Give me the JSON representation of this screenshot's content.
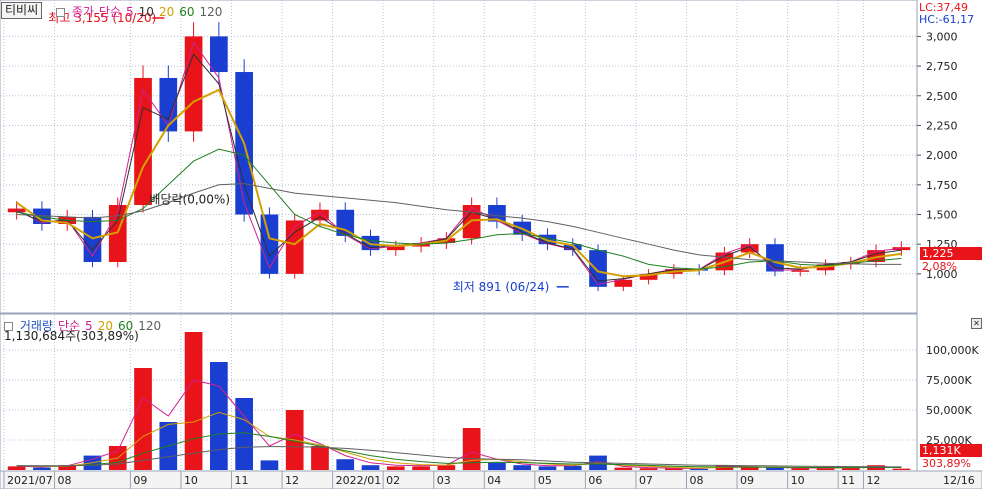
{
  "window": {
    "ticker": "티비씨"
  },
  "price_legend": {
    "items": [
      {
        "text": "종가",
        "color": "#d02090"
      },
      {
        "text": "단순",
        "color": "#d02090"
      },
      {
        "text": "5",
        "color": "#d02090"
      },
      {
        "text": "10",
        "color": "#303030"
      },
      {
        "text": "20",
        "color": "#d4a000"
      },
      {
        "text": "60",
        "color": "#208020"
      },
      {
        "text": "120",
        "color": "#606060"
      }
    ]
  },
  "volume_legend": {
    "items": [
      {
        "text": "거래량",
        "color": "#2050c0"
      },
      {
        "text": "단순",
        "color": "#d02090"
      },
      {
        "text": "5",
        "color": "#d02090"
      },
      {
        "text": "20",
        "color": "#d4a000"
      },
      {
        "text": "60",
        "color": "#208020"
      },
      {
        "text": "120",
        "color": "#606060"
      }
    ],
    "info": "1,130,684주(303,89%)"
  },
  "indicators": {
    "lc": "LC:37,49",
    "hc": "HC:-61,17"
  },
  "current": {
    "price_tag": "1,225",
    "change_tag": "2,08%",
    "vol_tag": "1,131K",
    "vol_pct_tag": "303,89%"
  },
  "colors": {
    "up": "#e8141a",
    "down": "#1a3fd0",
    "ma5": "#d02090",
    "ma10": "#303030",
    "ma20": "#d4a000",
    "ma60": "#208020",
    "ma120": "#606060",
    "grid": "#b8c4d8"
  },
  "chart_data": [
    {
      "type": "line",
      "title": "",
      "chart_kind": "candlestick with moving averages",
      "ylim": [
        780,
        3155
      ],
      "yticks": [
        "1,000",
        "1,250",
        "1,500",
        "1,750",
        "2,000",
        "2,250",
        "2,500",
        "2,750",
        "3,000"
      ],
      "yticks_values": [
        1000,
        1250,
        1500,
        1750,
        2000,
        2250,
        2500,
        2750,
        3000
      ],
      "x_ticks": [
        "2021/07",
        "08",
        "09",
        "10",
        "11",
        "12",
        "2022/01",
        "02",
        "03",
        "04",
        "05",
        "06",
        "07",
        "08",
        "09",
        "10",
        "11",
        "12",
        "12/16"
      ],
      "x": [
        "2021/07",
        "07",
        "08",
        "08",
        "09",
        "09",
        "10",
        "10",
        "11",
        "11",
        "12",
        "12",
        "2022/01",
        "01",
        "02",
        "02",
        "03",
        "03",
        "04",
        "04",
        "05",
        "05",
        "06",
        "06",
        "07",
        "07",
        "08",
        "08",
        "09",
        "09",
        "10",
        "10",
        "11",
        "11",
        "12",
        "12/16"
      ],
      "series": [
        {
          "name": "종가",
          "values": [
            1550,
            1420,
            1480,
            1100,
            1580,
            2650,
            2200,
            3000,
            2700,
            1500,
            1000,
            1450,
            1540,
            1320,
            1200,
            1230,
            1260,
            1300,
            1580,
            1440,
            1330,
            1250,
            1200,
            891,
            950,
            1000,
            1040,
            1030,
            1180,
            1250,
            1020,
            1030,
            1080,
            1100,
            1200,
            1225
          ]
        },
        {
          "name": "5",
          "values": [
            1540,
            1430,
            1460,
            1150,
            1520,
            2550,
            2250,
            2950,
            2650,
            1600,
            1050,
            1400,
            1520,
            1330,
            1210,
            1235,
            1260,
            1300,
            1560,
            1450,
            1340,
            1255,
            1205,
            910,
            955,
            1000,
            1040,
            1035,
            1170,
            1245,
            1030,
            1035,
            1080,
            1100,
            1190,
            1215
          ]
        },
        {
          "name": "10",
          "values": [
            1530,
            1440,
            1450,
            1200,
            1450,
            2400,
            2300,
            2850,
            2600,
            1750,
            1150,
            1350,
            1480,
            1340,
            1220,
            1240,
            1255,
            1295,
            1520,
            1460,
            1350,
            1260,
            1210,
            940,
            960,
            1000,
            1035,
            1035,
            1150,
            1230,
            1050,
            1040,
            1075,
            1100,
            1170,
            1200
          ]
        },
        {
          "name": "20",
          "values": [
            1600,
            1450,
            1430,
            1300,
            1350,
            1900,
            2250,
            2450,
            2550,
            2100,
            1300,
            1250,
            1420,
            1370,
            1250,
            1235,
            1250,
            1280,
            1450,
            1460,
            1380,
            1280,
            1240,
            1020,
            980,
            990,
            1020,
            1030,
            1100,
            1180,
            1100,
            1050,
            1060,
            1090,
            1140,
            1170
          ]
        },
        {
          "name": "60",
          "values": [
            1520,
            1480,
            1450,
            1440,
            1450,
            1550,
            1750,
            1950,
            2050,
            2000,
            1750,
            1500,
            1400,
            1330,
            1280,
            1260,
            1250,
            1260,
            1290,
            1330,
            1340,
            1300,
            1260,
            1200,
            1150,
            1080,
            1050,
            1040,
            1060,
            1100,
            1110,
            1080,
            1070,
            1090,
            1110,
            1130
          ]
        },
        {
          "name": "120",
          "values": [
            1500,
            1490,
            1480,
            1470,
            1490,
            1530,
            1600,
            1680,
            1750,
            1760,
            1720,
            1680,
            1660,
            1640,
            1620,
            1600,
            1570,
            1540,
            1520,
            1490,
            1470,
            1440,
            1400,
            1350,
            1300,
            1250,
            1200,
            1160,
            1140,
            1120,
            1110,
            1100,
            1090,
            1085,
            1080,
            1080
          ]
        }
      ],
      "annotations": [
        {
          "text": "최고 3,155 (10/20)",
          "x": "10",
          "y": 3155,
          "color": "#e8141a"
        },
        {
          "text": "배당락(0,00%)",
          "x": "12",
          "y": 1560,
          "color": "#222222"
        },
        {
          "text": "최저 891 (06/24)",
          "x": "06",
          "y": 891,
          "color": "#1a3fd0"
        }
      ]
    },
    {
      "type": "bar",
      "title": "",
      "chart_kind": "volume",
      "ylim": [
        0,
        120000
      ],
      "yticks": [
        "25,000K",
        "50,000K",
        "75,000K",
        "100,000K"
      ],
      "yticks_values": [
        25000,
        50000,
        75000,
        100000
      ],
      "x": [
        "2021/07",
        "07",
        "08",
        "08",
        "09",
        "09",
        "10",
        "10",
        "11",
        "11",
        "12",
        "12",
        "2022/01",
        "01",
        "02",
        "02",
        "03",
        "03",
        "04",
        "04",
        "05",
        "05",
        "06",
        "06",
        "07",
        "07",
        "08",
        "08",
        "09",
        "09",
        "10",
        "10",
        "11",
        "11",
        "12",
        "12/16"
      ],
      "series": [
        {
          "name": "거래량",
          "values": [
            3000,
            2000,
            4000,
            12000,
            20000,
            85000,
            40000,
            115000,
            90000,
            60000,
            8000,
            50000,
            20000,
            9000,
            4000,
            3000,
            3000,
            4000,
            35000,
            6000,
            4000,
            3000,
            3500,
            12000,
            2000,
            1500,
            1200,
            1000,
            4000,
            3000,
            2000,
            1500,
            1500,
            1800,
            4000,
            1131
          ]
        },
        {
          "name": "5",
          "values": [
            3200,
            2500,
            3500,
            9000,
            16000,
            60000,
            45000,
            75000,
            70000,
            45000,
            20000,
            30000,
            22000,
            12000,
            6000,
            4000,
            3500,
            4000,
            15000,
            9000,
            5000,
            3500,
            3500,
            7000,
            3000,
            2000,
            1500,
            1200,
            3000,
            2800,
            2200,
            1700,
            1600,
            1800,
            3000,
            2000
          ]
        },
        {
          "name": "20",
          "values": [
            3500,
            3000,
            3200,
            6000,
            10000,
            28000,
            38000,
            40000,
            48000,
            42000,
            28000,
            25000,
            21000,
            15000,
            9000,
            6000,
            4500,
            4000,
            8000,
            9000,
            7000,
            5000,
            4000,
            5500,
            4000,
            3000,
            2200,
            1600,
            2200,
            2500,
            2300,
            2000,
            1800,
            1800,
            2300,
            2200
          ]
        },
        {
          "name": "60",
          "values": [
            3500,
            3400,
            3300,
            4500,
            6500,
            14000,
            20000,
            26000,
            30000,
            31000,
            28000,
            24000,
            20000,
            16000,
            12000,
            9000,
            7000,
            5500,
            6000,
            6500,
            6200,
            5500,
            5000,
            5000,
            4500,
            3800,
            3200,
            2700,
            2500,
            2400,
            2300,
            2200,
            2100,
            2000,
            2100,
            2100
          ]
        },
        {
          "name": "120",
          "values": [
            3500,
            3500,
            3500,
            4000,
            5000,
            8000,
            11000,
            14000,
            17000,
            19000,
            19500,
            19500,
            19000,
            18000,
            16500,
            14500,
            12500,
            10500,
            9500,
            9000,
            8500,
            7500,
            6500,
            6000,
            5500,
            5000,
            4500,
            4000,
            3800,
            3600,
            3400,
            3200,
            3000,
            2800,
            2700,
            2600
          ]
        }
      ]
    }
  ]
}
